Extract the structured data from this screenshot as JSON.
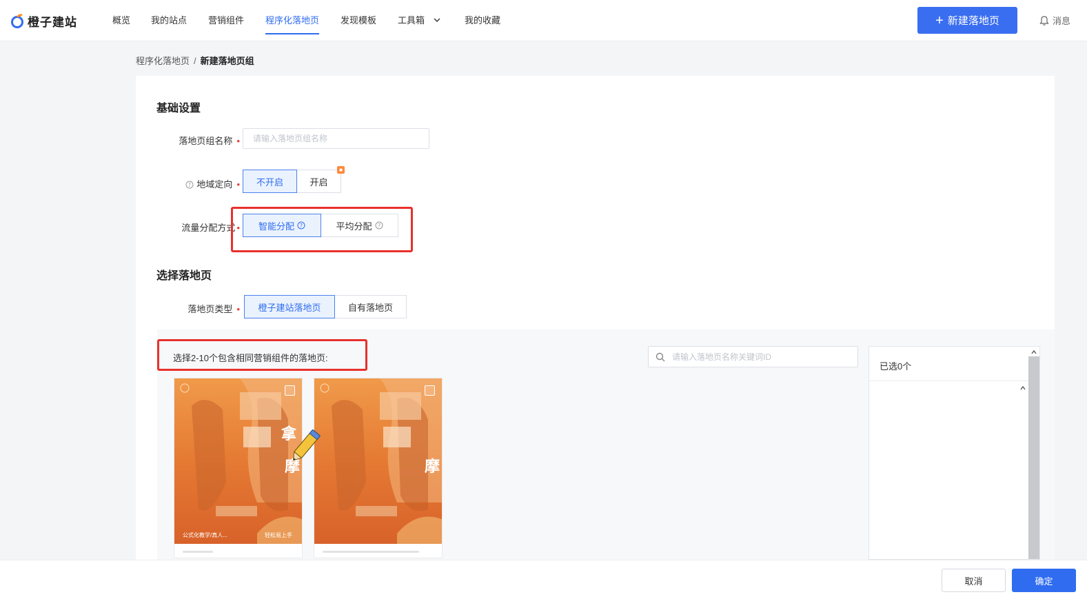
{
  "app": {
    "logo_text": "橙子建站"
  },
  "nav": {
    "items": [
      {
        "label": "概览"
      },
      {
        "label": "我的站点"
      },
      {
        "label": "营销组件"
      },
      {
        "label": "程序化落地页"
      },
      {
        "label": "发现模板"
      },
      {
        "label": "工具箱"
      },
      {
        "label": "我的收藏"
      }
    ],
    "active_index": 3,
    "new_button_label": "新建落地页",
    "messages_label": "消息"
  },
  "breadcrumb": {
    "parent": "程序化落地页",
    "separator": "/",
    "current": "新建落地页组"
  },
  "basic_settings": {
    "title": "基础设置",
    "group_name": {
      "label": "落地页组名称",
      "placeholder": "请输入落地页组名称",
      "value": ""
    },
    "geo_targeting": {
      "label": "地域定向",
      "options": [
        "不开启",
        "开启"
      ],
      "selected": "不开启"
    },
    "traffic_allocation": {
      "label": "流量分配方式",
      "options": [
        "智能分配",
        "平均分配"
      ],
      "selected": "智能分配"
    }
  },
  "select_pages": {
    "title": "选择落地页",
    "page_type": {
      "label": "落地页类型",
      "options": [
        "橙子建站落地页",
        "自有落地页"
      ],
      "selected": "橙子建站落地页"
    },
    "hint": "选择2-10个包含相同营销组件的落地页:",
    "search_placeholder": "请输入落地页名称关键词ID",
    "selected_count_label": "已选0个",
    "thumbnails": [
      {
        "caption_left": "公式化教学/真人...",
        "caption_right": "轻松易上手"
      },
      {
        "caption_left": "",
        "caption_right": ""
      }
    ]
  },
  "footer": {
    "cancel_label": "取消",
    "confirm_label": "确定"
  },
  "colors": {
    "brand_blue": "#2f6cf0",
    "highlight_red": "#e8302c",
    "thumb_orange": "#e8823a",
    "required_red": "#e53935"
  }
}
